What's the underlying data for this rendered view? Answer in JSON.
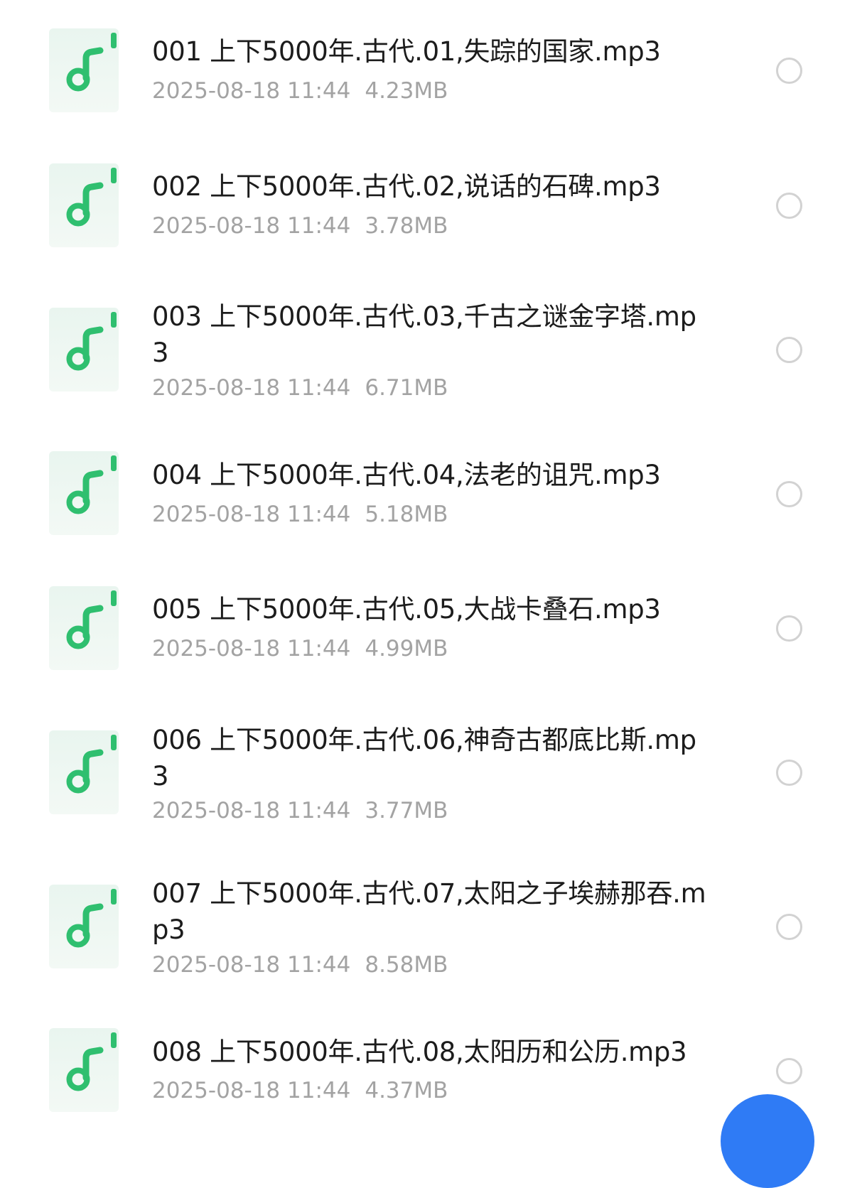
{
  "colors": {
    "icon_bg": "#e9f5ef",
    "icon_accent": "#2fbf6f",
    "name_text": "#1c1c1c",
    "meta_text": "#a3a3a3",
    "radio_border": "#d2d2d2",
    "fab": "#2f7bf5"
  },
  "files": [
    {
      "name": "001 上下5000年.古代.01,失踪的国家.mp3",
      "date": "2025-08-18 11:44",
      "size": "4.23MB",
      "icon": "music-file-icon",
      "selected": false
    },
    {
      "name": "002 上下5000年.古代.02,说话的石碑.mp3",
      "date": "2025-08-18 11:44",
      "size": "3.78MB",
      "icon": "music-file-icon",
      "selected": false
    },
    {
      "name": "003 上下5000年.古代.03,千古之谜金字塔.mp3",
      "date": "2025-08-18 11:44",
      "size": "6.71MB",
      "icon": "music-file-icon",
      "selected": false
    },
    {
      "name": "004 上下5000年.古代.04,法老的诅咒.mp3",
      "date": "2025-08-18 11:44",
      "size": "5.18MB",
      "icon": "music-file-icon",
      "selected": false
    },
    {
      "name": "005 上下5000年.古代.05,大战卡叠石.mp3",
      "date": "2025-08-18 11:44",
      "size": "4.99MB",
      "icon": "music-file-icon",
      "selected": false
    },
    {
      "name": "006 上下5000年.古代.06,神奇古都底比斯.mp3",
      "date": "2025-08-18 11:44",
      "size": "3.77MB",
      "icon": "music-file-icon",
      "selected": false
    },
    {
      "name": "007 上下5000年.古代.07,太阳之子埃赫那吞.mp3",
      "date": "2025-08-18 11:44",
      "size": "8.58MB",
      "icon": "music-file-icon",
      "selected": false
    },
    {
      "name": "008 上下5000年.古代.08,太阳历和公历.mp3",
      "date": "2025-08-18 11:44",
      "size": "4.37MB",
      "icon": "music-file-icon",
      "selected": false
    }
  ]
}
